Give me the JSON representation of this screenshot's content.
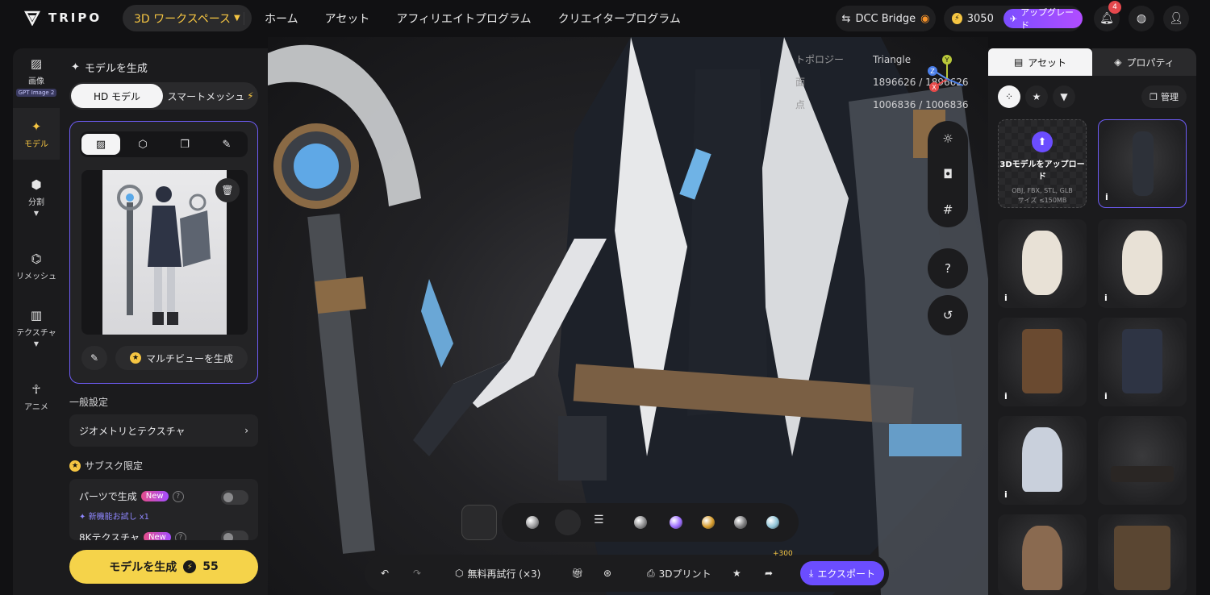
{
  "brand": {
    "name": "TRIPO"
  },
  "topbar": {
    "workspace": "3D ワークスペース",
    "nav": [
      "ホーム",
      "アセット",
      "アフィリエイトプログラム",
      "クリエイタープログラム"
    ],
    "dcc_bridge": "DCC Bridge",
    "credits": "3050",
    "upgrade": "アップグレード",
    "notifications": "4"
  },
  "rail": {
    "items": [
      {
        "label": "画像",
        "chip": "GPT Image 2",
        "icon": "image-icon"
      },
      {
        "label": "モデル",
        "icon": "sparkle-icon"
      },
      {
        "label": "分割",
        "icon": "cube-split-icon"
      },
      {
        "label": "リメッシュ",
        "icon": "mesh-icon"
      },
      {
        "label": "テクスチャ",
        "icon": "texture-icon"
      },
      {
        "label": "アニメ",
        "icon": "figure-icon"
      }
    ]
  },
  "panel": {
    "title": "モデルを生成",
    "mode_hd": "HD モデル",
    "mode_smart": "スマートメッシュ",
    "multiview_button": "マルチビューを生成",
    "general_settings": "一般設定",
    "geometry_texture": "ジオメトリとテクスチャ",
    "subscription_only": "サブスク限定",
    "parts_generate": "パーツで生成",
    "new_tag": "New",
    "trial_note": "新機能お試し x1",
    "texture_8k": "8Kテクスチャ",
    "generate_button": "モデルを生成",
    "generate_cost": "55"
  },
  "viewport": {
    "stats": [
      {
        "key": "トポロジー",
        "value": "Triangle"
      },
      {
        "key": "面",
        "value": "1896626 / 1896626"
      },
      {
        "key": "点",
        "value": "1006836 / 1006836"
      }
    ],
    "axes": {
      "x": "X",
      "y": "Y",
      "z": "Z"
    },
    "material_colors": [
      "#9a9a9c",
      "#c8c8ca",
      "#8a8a8c",
      "#9b6bff",
      "#d69b2a",
      "#7a7a7c",
      "#8fc3d6"
    ]
  },
  "bottombar": {
    "retry": "無料再試行 (×3)",
    "print3d": "3Dプリント",
    "plus": "+300",
    "export": "エクスポート"
  },
  "rpanel": {
    "tab_assets": "アセット",
    "tab_props": "プロパティ",
    "manage": "管理",
    "upload_title": "3Dモデルをアップロード",
    "upload_formats": "OBJ, FBX, STL, GLB",
    "upload_size": "サイズ ≤150MB",
    "info": "i"
  },
  "colors": {
    "accent": "#6e5cf6",
    "generate": "#f5d34a",
    "gold": "#f5c542"
  }
}
